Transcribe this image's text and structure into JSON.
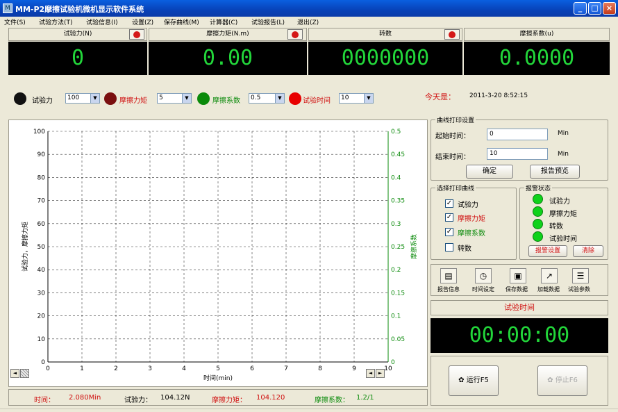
{
  "window": {
    "title": "MM-P2摩擦试验机微机显示软件系统",
    "icon_name": "app-icon",
    "controls": [
      "_",
      "□",
      "×"
    ]
  },
  "menu": [
    "文件(S)",
    "试验方法(T)",
    "试验信息(I)",
    "设置(Z)",
    "保存曲线(M)",
    "计算器(C)",
    "试验报告(L)",
    "退出(Z)"
  ],
  "counters": [
    {
      "label": "试验力(N)",
      "value": "0",
      "has_reset": true
    },
    {
      "label": "摩擦力矩(N.m)",
      "value": "0.00",
      "has_reset": true
    },
    {
      "label": "转数",
      "value": "0000000",
      "has_reset": true
    },
    {
      "label": "摩擦系数(u)",
      "value": "0.0000",
      "has_reset": false
    }
  ],
  "indicators": [
    {
      "label": "试验力",
      "color": "#111111",
      "label_color": "#000000",
      "select": "100"
    },
    {
      "label": "摩擦力矩",
      "color": "#7a0f0f",
      "label_color": "#d01010",
      "select": "5"
    },
    {
      "label": "摩擦系数",
      "color": "#0a8a0a",
      "label_color": "#0a8a0a",
      "select": "0.5"
    },
    {
      "label": "试验时间",
      "color": "#e80000",
      "label_color": "#d01010",
      "select": "10"
    }
  ],
  "today": {
    "label": "今天是：",
    "value": "2011-3-20 8:52:15"
  },
  "chart_data": {
    "type": "line",
    "xlabel": "时间(min)",
    "ylabel_left": "试验力，摩擦力矩",
    "ylabel_right": "摩擦系数",
    "x_ticks": [
      "0",
      "1",
      "2",
      "3",
      "4",
      "5",
      "6",
      "7",
      "8",
      "9",
      "10"
    ],
    "y_left_ticks": [
      "0",
      "10",
      "20",
      "30",
      "40",
      "50",
      "60",
      "70",
      "80",
      "90",
      "100"
    ],
    "y_right_ticks": [
      "0",
      "0.05",
      "0.1",
      "0.15",
      "0.2",
      "0.25",
      "0.3",
      "0.35",
      "0.4",
      "0.45",
      "0.5"
    ],
    "xlim": [
      0,
      10
    ],
    "ylim_left": [
      0,
      100
    ],
    "ylim_right": [
      0,
      0.5
    ],
    "grid": true,
    "series": []
  },
  "curve_print": {
    "title": "曲线打印设置",
    "start_label": "起始时间：",
    "start_value": "0",
    "start_unit": "Min",
    "end_label": "结束时间：",
    "end_value": "10",
    "end_unit": "Min",
    "confirm_button": "确定",
    "preview_button": "报告预览"
  },
  "curve_select": {
    "title": "选择打印曲线",
    "items": [
      {
        "label": "试验力",
        "checked": true,
        "color": "#000000"
      },
      {
        "label": "摩擦力矩",
        "checked": true,
        "color": "#d01010"
      },
      {
        "label": "摩擦系数",
        "checked": true,
        "color": "#0a8a0a"
      },
      {
        "label": "转数",
        "checked": false,
        "color": "#000000"
      }
    ]
  },
  "alarm": {
    "title": "报警状态",
    "items": [
      "试验力",
      "摩擦力矩",
      "转数",
      "试验时间"
    ],
    "settings_button": "报警设置",
    "clear_button": "清除"
  },
  "toolbar": [
    {
      "label": "报告信息",
      "icon": "report-icon"
    },
    {
      "label": "时间设定",
      "icon": "clock-icon"
    },
    {
      "label": "保存数据",
      "icon": "save-icon"
    },
    {
      "label": "加载数据",
      "icon": "load-icon"
    },
    {
      "label": "试验参数",
      "icon": "params-icon"
    }
  ],
  "timer": {
    "label": "试验时间",
    "value": "00:00:00"
  },
  "run_buttons": [
    {
      "label": "运行F5",
      "enabled": true,
      "icon": "run-icon"
    },
    {
      "label": "停止F6",
      "enabled": false,
      "icon": "stop-icon"
    }
  ],
  "status": {
    "time_label": "时间：",
    "time_value": "2.080Min",
    "force_label": "试验力：",
    "force_value": "104.12N",
    "torque_label": "摩擦力矩：",
    "torque_value": "104.120",
    "coef_label": "摩擦系数：",
    "coef_value": "1.2/1"
  }
}
